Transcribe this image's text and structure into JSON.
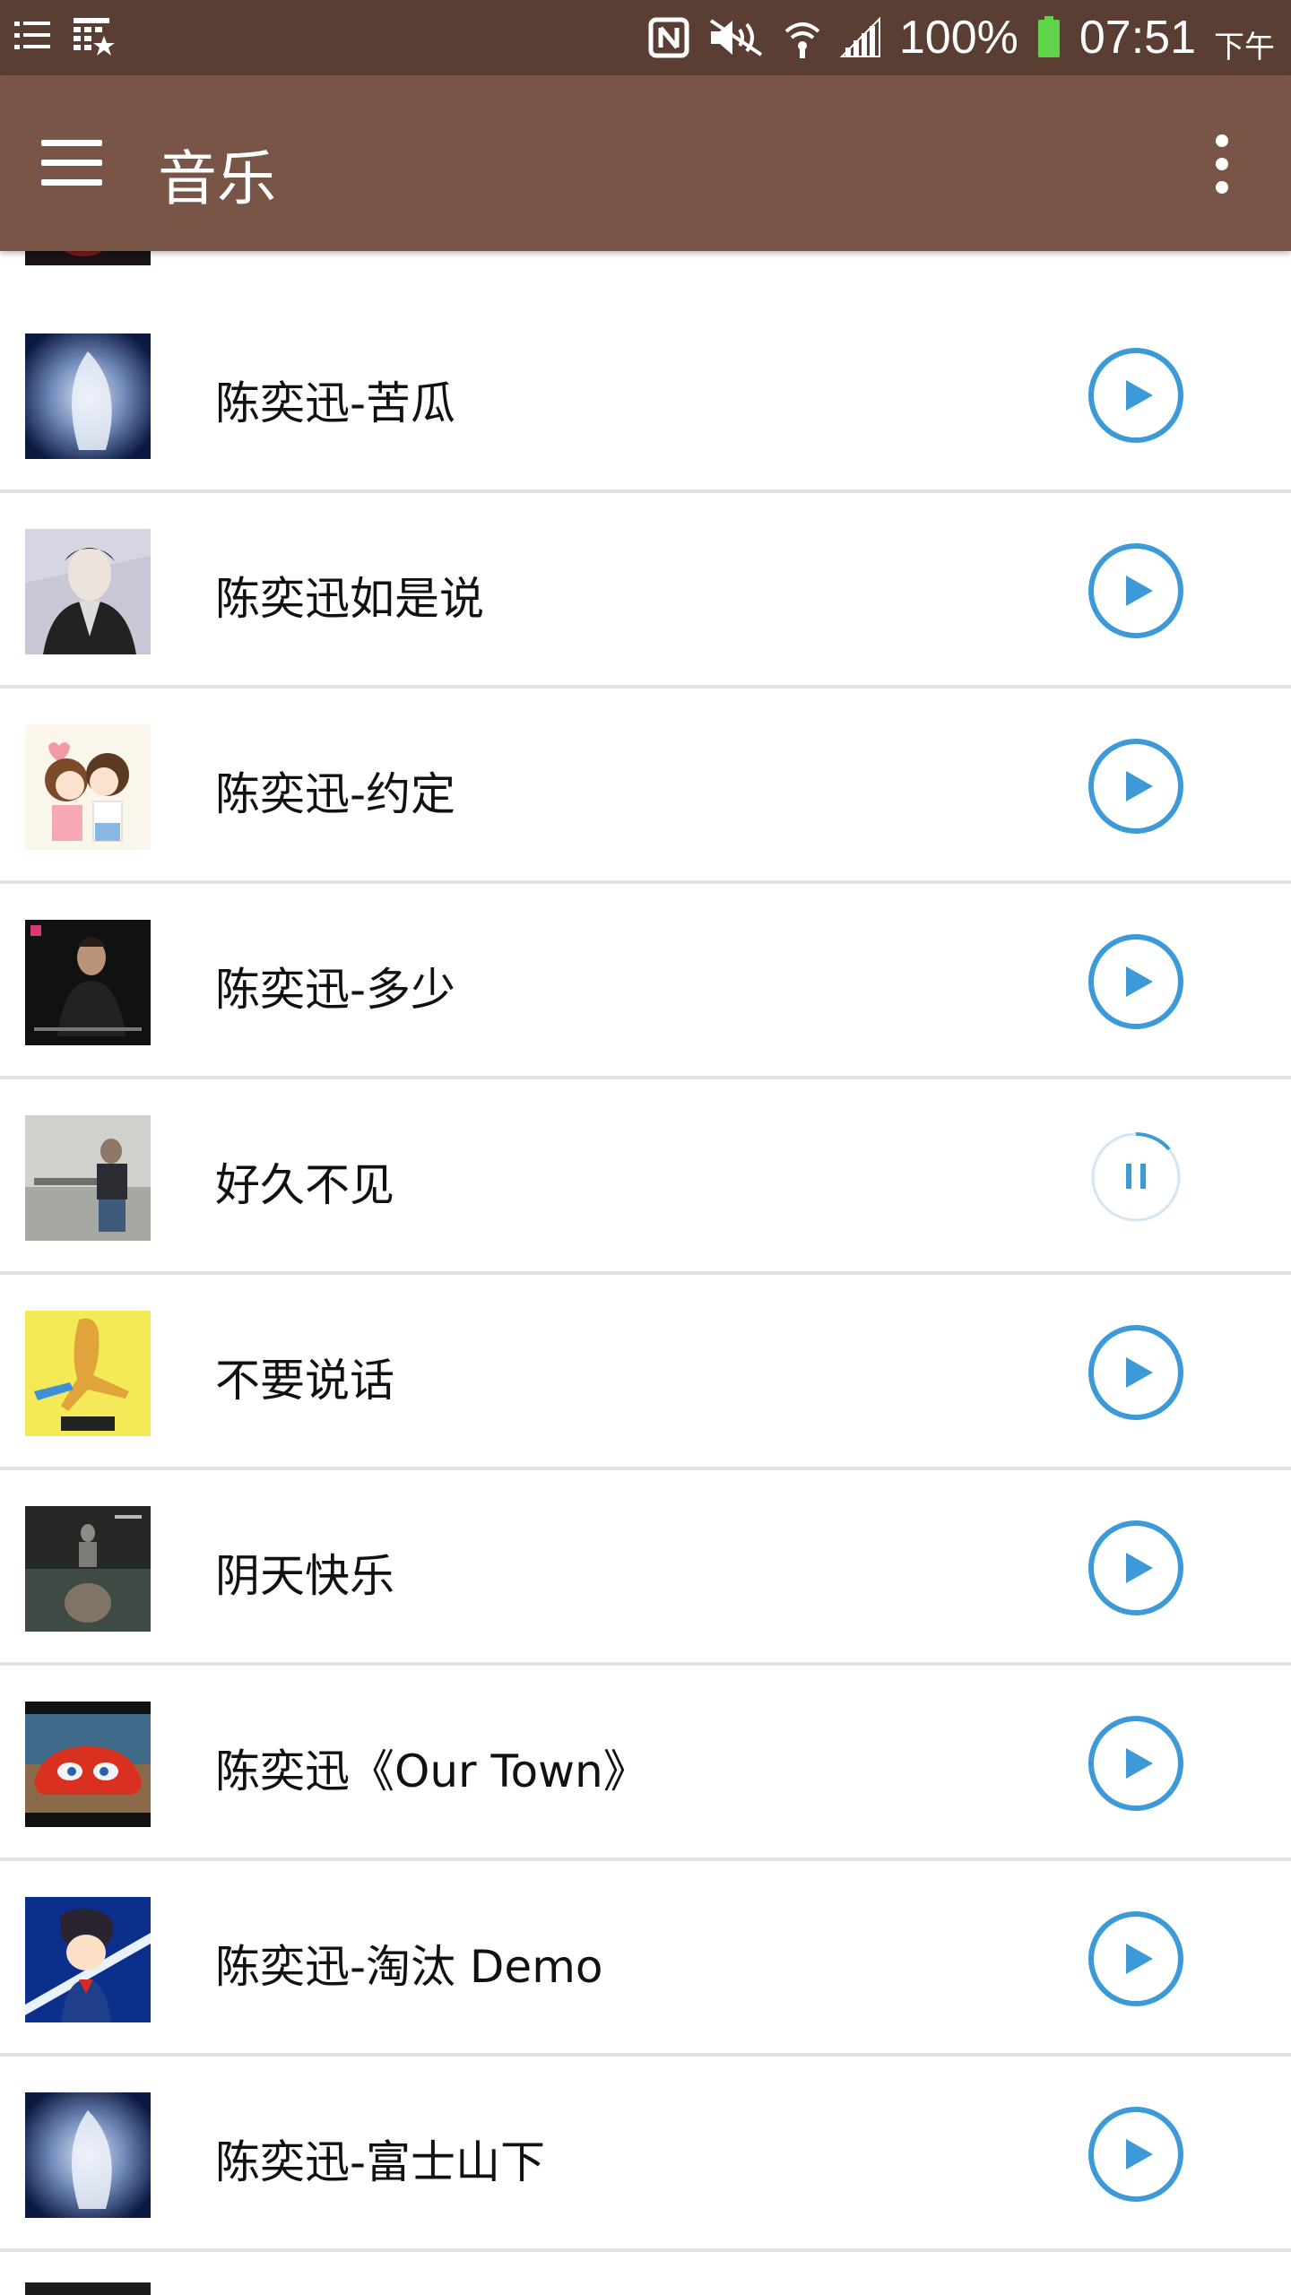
{
  "status_bar": {
    "battery": "100%",
    "time": "07:51",
    "ampm": "下午",
    "icons": [
      "list-icon",
      "calendar-star-icon",
      "nfc-icon",
      "mute-icon",
      "wifi-icon",
      "signal-icon",
      "battery-icon"
    ]
  },
  "toolbar": {
    "title": "音乐",
    "menu_icon": "hamburger-menu-icon",
    "overflow_icon": "more-vertical-icon"
  },
  "songs": [
    {
      "title": "陈奕迅-苦瓜",
      "state": "play"
    },
    {
      "title": "陈奕迅如是说",
      "state": "play"
    },
    {
      "title": "陈奕迅-约定",
      "state": "play"
    },
    {
      "title": "陈奕迅-多少",
      "state": "play"
    },
    {
      "title": "好久不见",
      "state": "loading-pause"
    },
    {
      "title": "不要说话",
      "state": "play"
    },
    {
      "title": "阴天快乐",
      "state": "play"
    },
    {
      "title": "陈奕迅《Our Town》",
      "state": "play"
    },
    {
      "title": "陈奕迅-淘汰 Demo",
      "state": "play"
    },
    {
      "title": "陈奕迅-富士山下",
      "state": "play"
    }
  ],
  "colors": {
    "status_bar": "#5a3d33",
    "toolbar": "#785546",
    "accent": "#3d9ad8",
    "divider": "#e3e3e3"
  }
}
